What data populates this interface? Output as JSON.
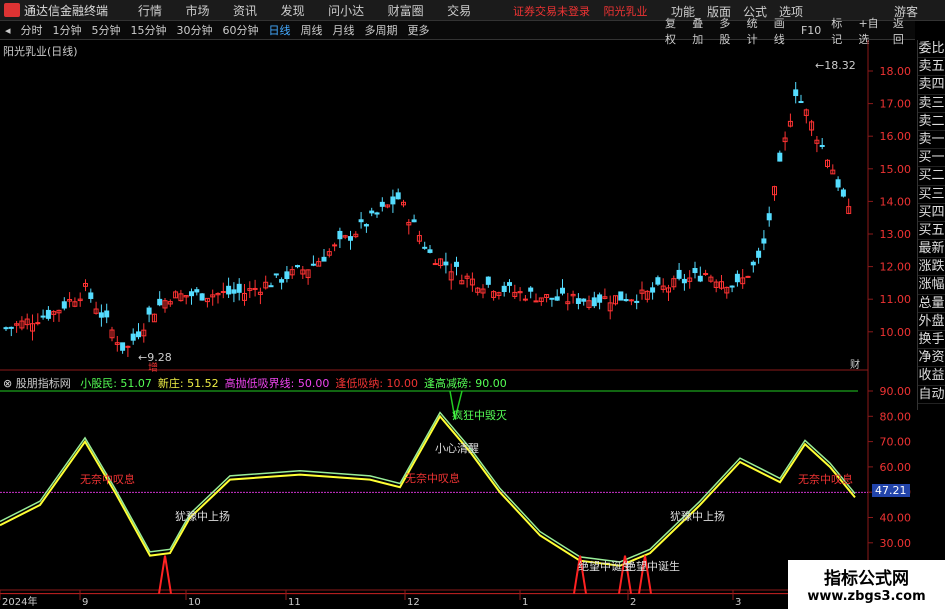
{
  "topbar": {
    "app_name": "通达信金融终端",
    "menu": [
      "行情",
      "市场",
      "资讯",
      "发现",
      "问小达",
      "财富圈",
      "交易"
    ],
    "warning": "证券交易未登录",
    "stock_name": "阳光乳业",
    "right_menu": [
      "功能",
      "版面",
      "公式",
      "选项"
    ],
    "user": "游客"
  },
  "tabbar": {
    "periods": [
      "分时",
      "1分钟",
      "5分钟",
      "15分钟",
      "30分钟",
      "60分钟",
      "日线",
      "周线",
      "月线",
      "多周期",
      "更多"
    ],
    "active": "日线",
    "right_buttons": [
      "复权",
      "叠加",
      "多股",
      "统计",
      "画线",
      "F10",
      "标记",
      "+自选",
      "返回"
    ]
  },
  "side_panel": [
    "委比",
    "卖五",
    "卖四",
    "卖三",
    "卖二",
    "卖一",
    "买一",
    "买二",
    "买三",
    "买四",
    "买五",
    "最新",
    "涨跌",
    "涨幅",
    "总量",
    "外盘",
    "换手",
    "净资",
    "收益",
    "自动"
  ],
  "main_chart": {
    "title": "阳光乳业(日线)",
    "y_ticks": [
      "18.00",
      "17.00",
      "16.00",
      "15.00",
      "14.00",
      "13.00",
      "12.00",
      "11.00",
      "10.00"
    ],
    "max_label": "18.32",
    "min_label": "9.28",
    "marker": "增",
    "badge": "财"
  },
  "indicator": {
    "name": "股朋指标网",
    "values": [
      {
        "label": "小股民:",
        "value": "51.07",
        "color": "#5f5"
      },
      {
        "label": "新庄:",
        "value": "51.52",
        "color": "#ee4"
      },
      {
        "label": "高抛低吸界线:",
        "value": "50.00",
        "color": "#e4e"
      },
      {
        "label": "逢低吸纳:",
        "value": "10.00",
        "color": "#e33"
      },
      {
        "label": "逢高减磅:",
        "value": "90.00",
        "color": "#5f5"
      }
    ],
    "y_ticks": [
      "90.00",
      "80.00",
      "70.00",
      "60.00",
      "50.00",
      "40.00",
      "30.00"
    ],
    "current": "47.21",
    "annotations": [
      {
        "text": "无奈中叹息",
        "color": "#e33"
      },
      {
        "text": "犹豫中上扬",
        "color": "#ddd"
      },
      {
        "text": "无奈中叹息",
        "color": "#e33"
      },
      {
        "text": "小心清醒",
        "color": "#ddd"
      },
      {
        "text": "疯狂中毁灭",
        "color": "#5f5"
      },
      {
        "text": "绝望中诞生",
        "color": "#ddd"
      },
      {
        "text": "犹豫中上扬",
        "color": "#ddd"
      },
      {
        "text": "无奈中叹息",
        "color": "#e33"
      },
      {
        "text": "绝望中诞生",
        "color": "#ddd"
      }
    ]
  },
  "x_axis": [
    "2024年",
    "9",
    "10",
    "11",
    "12",
    "1",
    "2",
    "3"
  ],
  "watermark": {
    "line1": "指标公式网",
    "line2": "www.zbgs3.com"
  }
}
